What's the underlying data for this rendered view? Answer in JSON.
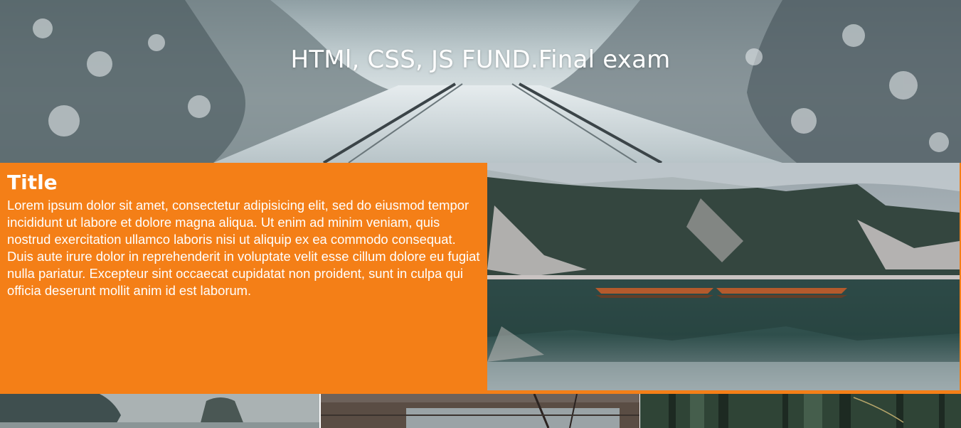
{
  "hero": {
    "title": "HTMl, CSS, JS FUND.Final exam",
    "image": "snowy-railway-forest-photo"
  },
  "content": {
    "title": "Title",
    "body": "Lorem ipsum dolor sit amet, consectetur adipisicing elit, sed do eiusmod tempor incididunt ut labore et dolore magna aliqua. Ut enim ad minim veniam, quis nostrud exercitation ullamco laboris nisi ut aliquip ex ea commodo consequat. Duis aute irure dolor in reprehenderit in voluptate velit esse cillum dolore eu fugiat nulla pariatur. Excepteur sint occaecat cupidatat non proident, sunt in culpa qui officia deserunt mollit anim id est laborum.",
    "background_color": "#f47f17",
    "image": "mountain-lake-boats-photo"
  },
  "gallery": [
    {
      "image": "foggy-trees-photo"
    },
    {
      "image": "river-trees-photo"
    },
    {
      "image": "forest-trunks-photo"
    }
  ]
}
